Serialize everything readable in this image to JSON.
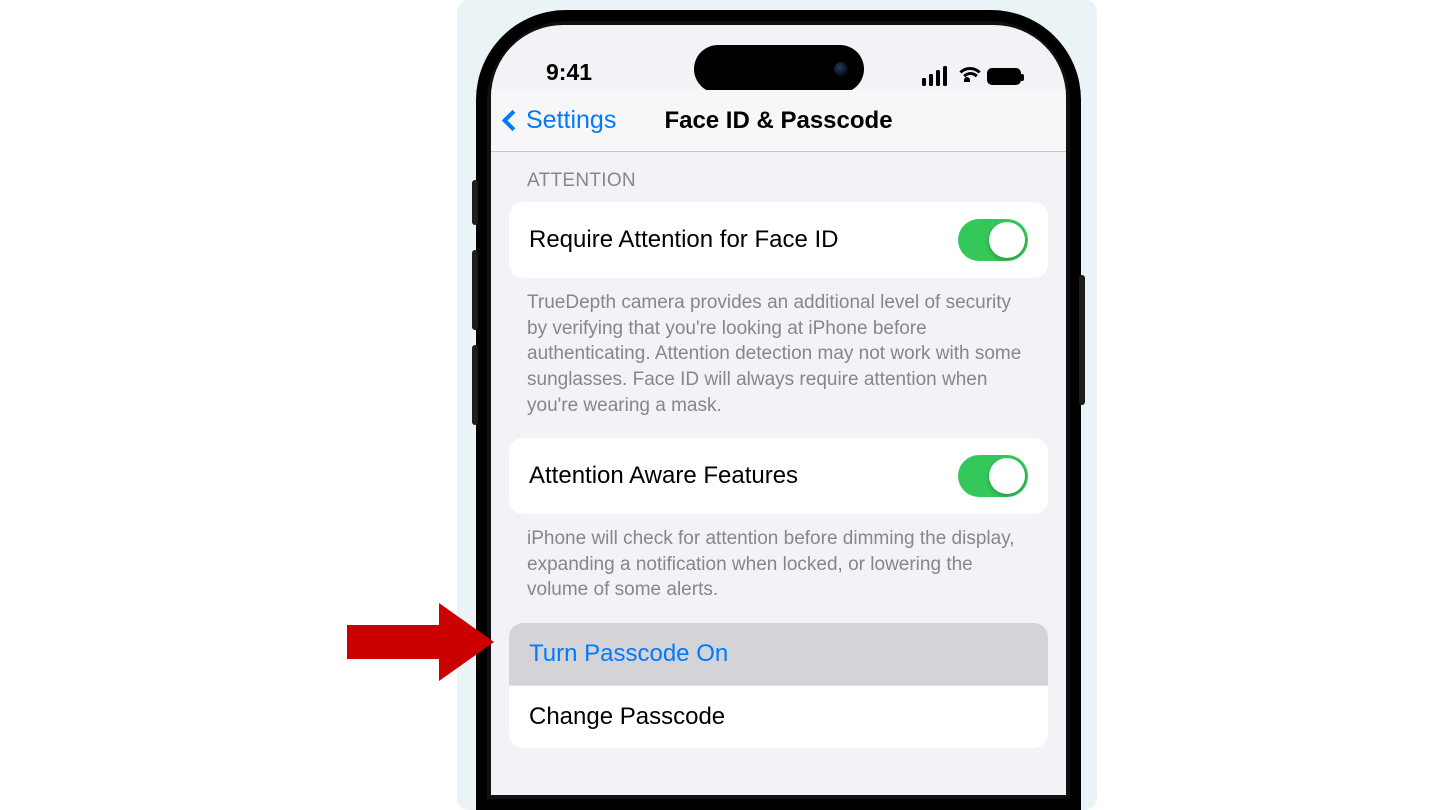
{
  "status": {
    "time": "9:41"
  },
  "nav": {
    "back_label": "Settings",
    "title": "Face ID & Passcode"
  },
  "attention": {
    "header": "ATTENTION",
    "require_label": "Require Attention for Face ID",
    "require_footer": "TrueDepth camera provides an additional level of security by verifying that you're looking at iPhone before authenticating. Attention detection may not work with some sunglasses. Face ID will always require attention when you're wearing a mask.",
    "aware_label": "Attention Aware Features",
    "aware_footer": "iPhone will check for attention before dimming the display, expanding a notification when locked, or lowering the volume of some alerts."
  },
  "passcode": {
    "turn_on_label": "Turn Passcode On",
    "change_label": "Change Passcode"
  }
}
